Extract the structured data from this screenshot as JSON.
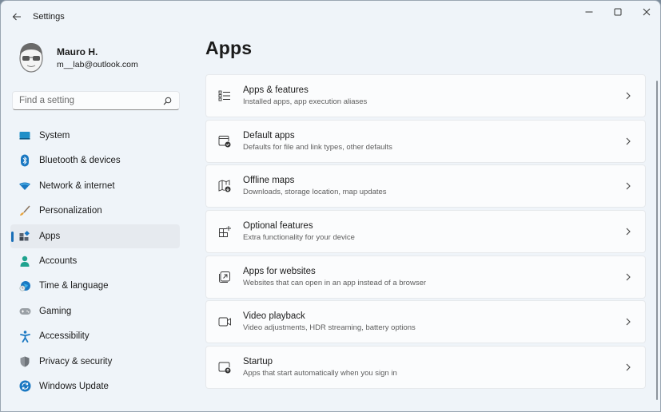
{
  "window": {
    "title": "Settings",
    "controls": [
      "minimize",
      "maximize",
      "close"
    ]
  },
  "profile": {
    "name": "Mauro H.",
    "email": "m__lab@outlook.com"
  },
  "search": {
    "placeholder": "Find a setting"
  },
  "sidebar": {
    "items": [
      {
        "label": "System",
        "icon": "monitor-icon"
      },
      {
        "label": "Bluetooth & devices",
        "icon": "bluetooth-icon"
      },
      {
        "label": "Network & internet",
        "icon": "wifi-icon"
      },
      {
        "label": "Personalization",
        "icon": "brush-icon"
      },
      {
        "label": "Apps",
        "icon": "apps-icon",
        "active": true
      },
      {
        "label": "Accounts",
        "icon": "person-icon"
      },
      {
        "label": "Time & language",
        "icon": "globe-clock-icon"
      },
      {
        "label": "Gaming",
        "icon": "gamepad-icon"
      },
      {
        "label": "Accessibility",
        "icon": "accessibility-icon"
      },
      {
        "label": "Privacy & security",
        "icon": "shield-icon"
      },
      {
        "label": "Windows Update",
        "icon": "update-icon"
      }
    ]
  },
  "main": {
    "title": "Apps",
    "cards": [
      {
        "title": "Apps & features",
        "description": "Installed apps, app execution aliases",
        "icon": "list-icon"
      },
      {
        "title": "Default apps",
        "description": "Defaults for file and link types, other defaults",
        "icon": "default-apps-icon"
      },
      {
        "title": "Offline maps",
        "description": "Downloads, storage location, map updates",
        "icon": "map-download-icon"
      },
      {
        "title": "Optional features",
        "description": "Extra functionality for your device",
        "icon": "grid-plus-icon"
      },
      {
        "title": "Apps for websites",
        "description": "Websites that can open in an app instead of a browser",
        "icon": "open-external-icon"
      },
      {
        "title": "Video playback",
        "description": "Video adjustments, HDR streaming, battery options",
        "icon": "video-icon"
      },
      {
        "title": "Startup",
        "description": "Apps that start automatically when you sign in",
        "icon": "startup-icon"
      }
    ]
  },
  "colors": {
    "accent": "#1a6fb8",
    "background": "#eff4f9",
    "card": "#fbfcfd"
  }
}
